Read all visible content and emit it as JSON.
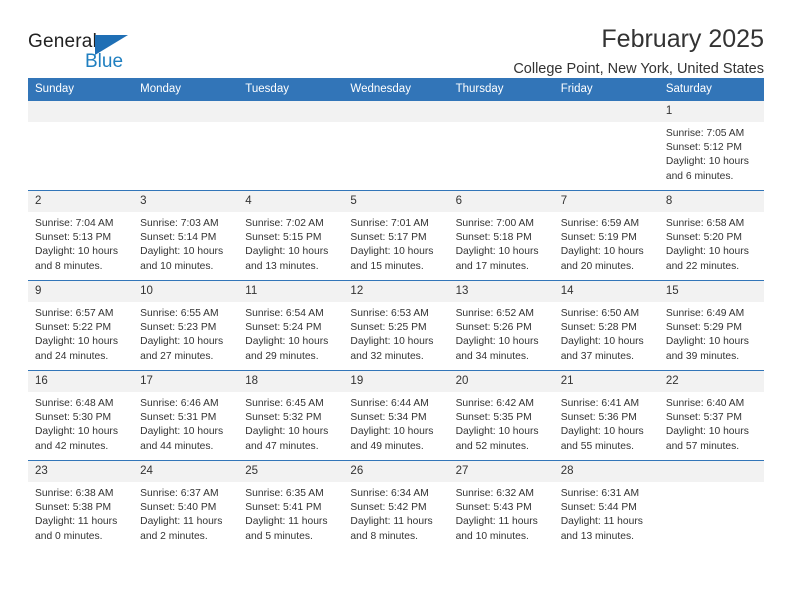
{
  "brand": {
    "name_top": "General",
    "name_bottom": "Blue",
    "accent_color": "#1f6fb5"
  },
  "header": {
    "title": "February 2025",
    "subtitle": "College Point, New York, United States"
  },
  "calendar": {
    "header_bg": "#3275b8",
    "daynum_bg": "#f2f2f2",
    "weekday_headers": [
      "Sunday",
      "Monday",
      "Tuesday",
      "Wednesday",
      "Thursday",
      "Friday",
      "Saturday"
    ],
    "weeks": [
      [
        {
          "day": "",
          "sunrise": "",
          "sunset": "",
          "daylight_1": "",
          "daylight_2": ""
        },
        {
          "day": "",
          "sunrise": "",
          "sunset": "",
          "daylight_1": "",
          "daylight_2": ""
        },
        {
          "day": "",
          "sunrise": "",
          "sunset": "",
          "daylight_1": "",
          "daylight_2": ""
        },
        {
          "day": "",
          "sunrise": "",
          "sunset": "",
          "daylight_1": "",
          "daylight_2": ""
        },
        {
          "day": "",
          "sunrise": "",
          "sunset": "",
          "daylight_1": "",
          "daylight_2": ""
        },
        {
          "day": "",
          "sunrise": "",
          "sunset": "",
          "daylight_1": "",
          "daylight_2": ""
        },
        {
          "day": "1",
          "sunrise": "Sunrise: 7:05 AM",
          "sunset": "Sunset: 5:12 PM",
          "daylight_1": "Daylight: 10 hours",
          "daylight_2": "and 6 minutes."
        }
      ],
      [
        {
          "day": "2",
          "sunrise": "Sunrise: 7:04 AM",
          "sunset": "Sunset: 5:13 PM",
          "daylight_1": "Daylight: 10 hours",
          "daylight_2": "and 8 minutes."
        },
        {
          "day": "3",
          "sunrise": "Sunrise: 7:03 AM",
          "sunset": "Sunset: 5:14 PM",
          "daylight_1": "Daylight: 10 hours",
          "daylight_2": "and 10 minutes."
        },
        {
          "day": "4",
          "sunrise": "Sunrise: 7:02 AM",
          "sunset": "Sunset: 5:15 PM",
          "daylight_1": "Daylight: 10 hours",
          "daylight_2": "and 13 minutes."
        },
        {
          "day": "5",
          "sunrise": "Sunrise: 7:01 AM",
          "sunset": "Sunset: 5:17 PM",
          "daylight_1": "Daylight: 10 hours",
          "daylight_2": "and 15 minutes."
        },
        {
          "day": "6",
          "sunrise": "Sunrise: 7:00 AM",
          "sunset": "Sunset: 5:18 PM",
          "daylight_1": "Daylight: 10 hours",
          "daylight_2": "and 17 minutes."
        },
        {
          "day": "7",
          "sunrise": "Sunrise: 6:59 AM",
          "sunset": "Sunset: 5:19 PM",
          "daylight_1": "Daylight: 10 hours",
          "daylight_2": "and 20 minutes."
        },
        {
          "day": "8",
          "sunrise": "Sunrise: 6:58 AM",
          "sunset": "Sunset: 5:20 PM",
          "daylight_1": "Daylight: 10 hours",
          "daylight_2": "and 22 minutes."
        }
      ],
      [
        {
          "day": "9",
          "sunrise": "Sunrise: 6:57 AM",
          "sunset": "Sunset: 5:22 PM",
          "daylight_1": "Daylight: 10 hours",
          "daylight_2": "and 24 minutes."
        },
        {
          "day": "10",
          "sunrise": "Sunrise: 6:55 AM",
          "sunset": "Sunset: 5:23 PM",
          "daylight_1": "Daylight: 10 hours",
          "daylight_2": "and 27 minutes."
        },
        {
          "day": "11",
          "sunrise": "Sunrise: 6:54 AM",
          "sunset": "Sunset: 5:24 PM",
          "daylight_1": "Daylight: 10 hours",
          "daylight_2": "and 29 minutes."
        },
        {
          "day": "12",
          "sunrise": "Sunrise: 6:53 AM",
          "sunset": "Sunset: 5:25 PM",
          "daylight_1": "Daylight: 10 hours",
          "daylight_2": "and 32 minutes."
        },
        {
          "day": "13",
          "sunrise": "Sunrise: 6:52 AM",
          "sunset": "Sunset: 5:26 PM",
          "daylight_1": "Daylight: 10 hours",
          "daylight_2": "and 34 minutes."
        },
        {
          "day": "14",
          "sunrise": "Sunrise: 6:50 AM",
          "sunset": "Sunset: 5:28 PM",
          "daylight_1": "Daylight: 10 hours",
          "daylight_2": "and 37 minutes."
        },
        {
          "day": "15",
          "sunrise": "Sunrise: 6:49 AM",
          "sunset": "Sunset: 5:29 PM",
          "daylight_1": "Daylight: 10 hours",
          "daylight_2": "and 39 minutes."
        }
      ],
      [
        {
          "day": "16",
          "sunrise": "Sunrise: 6:48 AM",
          "sunset": "Sunset: 5:30 PM",
          "daylight_1": "Daylight: 10 hours",
          "daylight_2": "and 42 minutes."
        },
        {
          "day": "17",
          "sunrise": "Sunrise: 6:46 AM",
          "sunset": "Sunset: 5:31 PM",
          "daylight_1": "Daylight: 10 hours",
          "daylight_2": "and 44 minutes."
        },
        {
          "day": "18",
          "sunrise": "Sunrise: 6:45 AM",
          "sunset": "Sunset: 5:32 PM",
          "daylight_1": "Daylight: 10 hours",
          "daylight_2": "and 47 minutes."
        },
        {
          "day": "19",
          "sunrise": "Sunrise: 6:44 AM",
          "sunset": "Sunset: 5:34 PM",
          "daylight_1": "Daylight: 10 hours",
          "daylight_2": "and 49 minutes."
        },
        {
          "day": "20",
          "sunrise": "Sunrise: 6:42 AM",
          "sunset": "Sunset: 5:35 PM",
          "daylight_1": "Daylight: 10 hours",
          "daylight_2": "and 52 minutes."
        },
        {
          "day": "21",
          "sunrise": "Sunrise: 6:41 AM",
          "sunset": "Sunset: 5:36 PM",
          "daylight_1": "Daylight: 10 hours",
          "daylight_2": "and 55 minutes."
        },
        {
          "day": "22",
          "sunrise": "Sunrise: 6:40 AM",
          "sunset": "Sunset: 5:37 PM",
          "daylight_1": "Daylight: 10 hours",
          "daylight_2": "and 57 minutes."
        }
      ],
      [
        {
          "day": "23",
          "sunrise": "Sunrise: 6:38 AM",
          "sunset": "Sunset: 5:38 PM",
          "daylight_1": "Daylight: 11 hours",
          "daylight_2": "and 0 minutes."
        },
        {
          "day": "24",
          "sunrise": "Sunrise: 6:37 AM",
          "sunset": "Sunset: 5:40 PM",
          "daylight_1": "Daylight: 11 hours",
          "daylight_2": "and 2 minutes."
        },
        {
          "day": "25",
          "sunrise": "Sunrise: 6:35 AM",
          "sunset": "Sunset: 5:41 PM",
          "daylight_1": "Daylight: 11 hours",
          "daylight_2": "and 5 minutes."
        },
        {
          "day": "26",
          "sunrise": "Sunrise: 6:34 AM",
          "sunset": "Sunset: 5:42 PM",
          "daylight_1": "Daylight: 11 hours",
          "daylight_2": "and 8 minutes."
        },
        {
          "day": "27",
          "sunrise": "Sunrise: 6:32 AM",
          "sunset": "Sunset: 5:43 PM",
          "daylight_1": "Daylight: 11 hours",
          "daylight_2": "and 10 minutes."
        },
        {
          "day": "28",
          "sunrise": "Sunrise: 6:31 AM",
          "sunset": "Sunset: 5:44 PM",
          "daylight_1": "Daylight: 11 hours",
          "daylight_2": "and 13 minutes."
        },
        {
          "day": "",
          "sunrise": "",
          "sunset": "",
          "daylight_1": "",
          "daylight_2": ""
        }
      ]
    ]
  }
}
